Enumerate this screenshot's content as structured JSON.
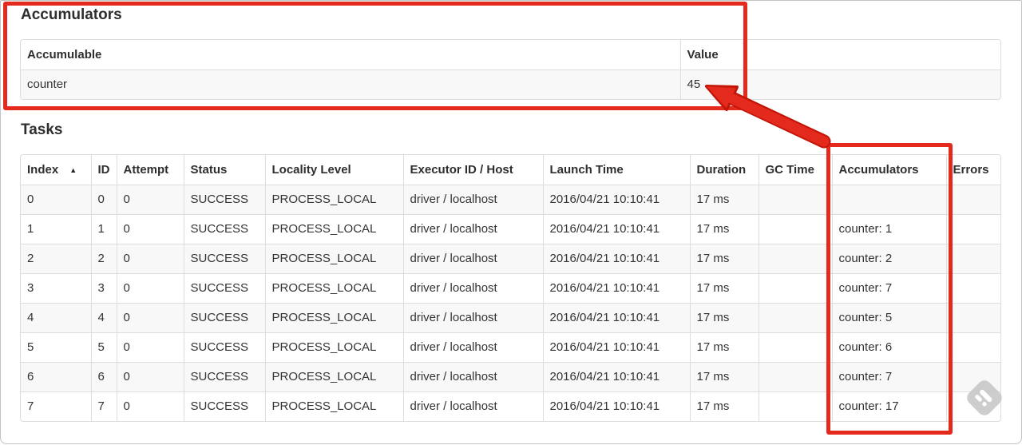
{
  "accumulators_section": {
    "title": "Accumulators",
    "table": {
      "columns": [
        "Accumulable",
        "Value"
      ],
      "rows": [
        [
          "counter",
          "45"
        ]
      ]
    }
  },
  "tasks_section": {
    "title": "Tasks",
    "table": {
      "columns": [
        "Index",
        "ID",
        "Attempt",
        "Status",
        "Locality Level",
        "Executor ID / Host",
        "Launch Time",
        "Duration",
        "GC Time",
        "Accumulators",
        "Errors"
      ],
      "sorted_column": "Index",
      "sort_indicator": "▲",
      "rows": [
        [
          "0",
          "0",
          "0",
          "SUCCESS",
          "PROCESS_LOCAL",
          "driver / localhost",
          "2016/04/21 10:10:41",
          "17 ms",
          "",
          "",
          ""
        ],
        [
          "1",
          "1",
          "0",
          "SUCCESS",
          "PROCESS_LOCAL",
          "driver / localhost",
          "2016/04/21 10:10:41",
          "17 ms",
          "",
          "counter: 1",
          ""
        ],
        [
          "2",
          "2",
          "0",
          "SUCCESS",
          "PROCESS_LOCAL",
          "driver / localhost",
          "2016/04/21 10:10:41",
          "17 ms",
          "",
          "counter: 2",
          ""
        ],
        [
          "3",
          "3",
          "0",
          "SUCCESS",
          "PROCESS_LOCAL",
          "driver / localhost",
          "2016/04/21 10:10:41",
          "17 ms",
          "",
          "counter: 7",
          ""
        ],
        [
          "4",
          "4",
          "0",
          "SUCCESS",
          "PROCESS_LOCAL",
          "driver / localhost",
          "2016/04/21 10:10:41",
          "17 ms",
          "",
          "counter: 5",
          ""
        ],
        [
          "5",
          "5",
          "0",
          "SUCCESS",
          "PROCESS_LOCAL",
          "driver / localhost",
          "2016/04/21 10:10:41",
          "17 ms",
          "",
          "counter: 6",
          ""
        ],
        [
          "6",
          "6",
          "0",
          "SUCCESS",
          "PROCESS_LOCAL",
          "driver / localhost",
          "2016/04/21 10:10:41",
          "17 ms",
          "",
          "counter: 7",
          ""
        ],
        [
          "7",
          "7",
          "0",
          "SUCCESS",
          "PROCESS_LOCAL",
          "driver / localhost",
          "2016/04/21 10:10:41",
          "17 ms",
          "",
          "counter: 17",
          ""
        ]
      ]
    }
  },
  "annotations": {
    "color": "#e42a1c",
    "boxes": [
      "accumulators-section",
      "accumulators-column"
    ],
    "arrow_target": "45"
  },
  "icons": {
    "watermark": "skitch-watermark-icon",
    "sort": "sort-ascending-icon"
  }
}
